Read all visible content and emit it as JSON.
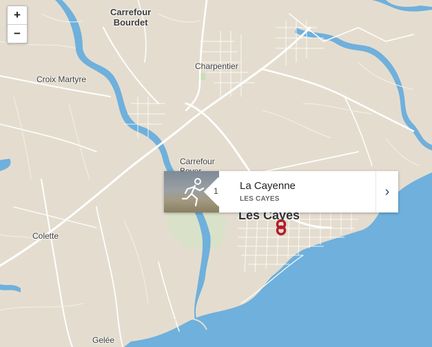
{
  "map": {
    "labels": [
      {
        "id": "carrefour-bourdet",
        "text": "Carrefour\nBourdet"
      },
      {
        "id": "charpentier",
        "text": "Charpentier"
      },
      {
        "id": "croix-martyre",
        "text": "Croix Martyre"
      },
      {
        "id": "carrefour-boyer",
        "text": "Carrefour\nBoyer"
      },
      {
        "id": "les-cayes",
        "text": "Les Cayes"
      },
      {
        "id": "colette",
        "text": "Colette"
      },
      {
        "id": "gelee",
        "text": "Gelée"
      }
    ],
    "colors": {
      "land": "#e4ddcf",
      "water": "#6fb0dc",
      "roads": "#ffffff",
      "park": "#c7dfb5"
    }
  },
  "zoom": {
    "in_label": "+",
    "out_label": "−"
  },
  "popup": {
    "index": "1",
    "title": "La Cayenne",
    "subtitle": "LES CAYES",
    "chevron": "›",
    "thumbnail_icon": "runner-icon"
  },
  "marker": {
    "icon": "map-pin-icon",
    "color": "#b01e2a"
  }
}
